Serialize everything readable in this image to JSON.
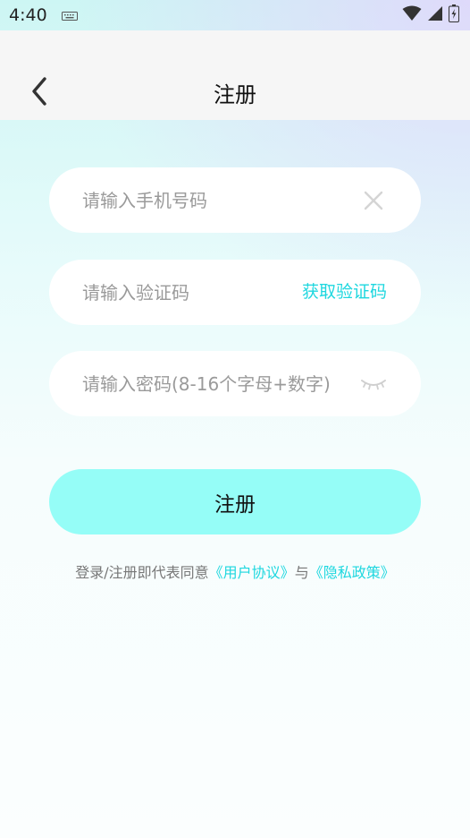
{
  "status_bar": {
    "time": "4:40"
  },
  "header": {
    "title": "注册"
  },
  "form": {
    "phone_placeholder": "请输入手机号码",
    "code_placeholder": "请输入验证码",
    "get_code_label": "获取验证码",
    "password_placeholder": "请输入密码(8-16个字母+数字)",
    "submit_label": "注册"
  },
  "agreement": {
    "prefix": "登录/注册即代表同意",
    "user_agreement": "《用户协议》",
    "conjunction": "与",
    "privacy_policy": "《隐私政策》"
  },
  "colors": {
    "accent": "#1ed7df",
    "button_bg": "#95fdf7"
  }
}
